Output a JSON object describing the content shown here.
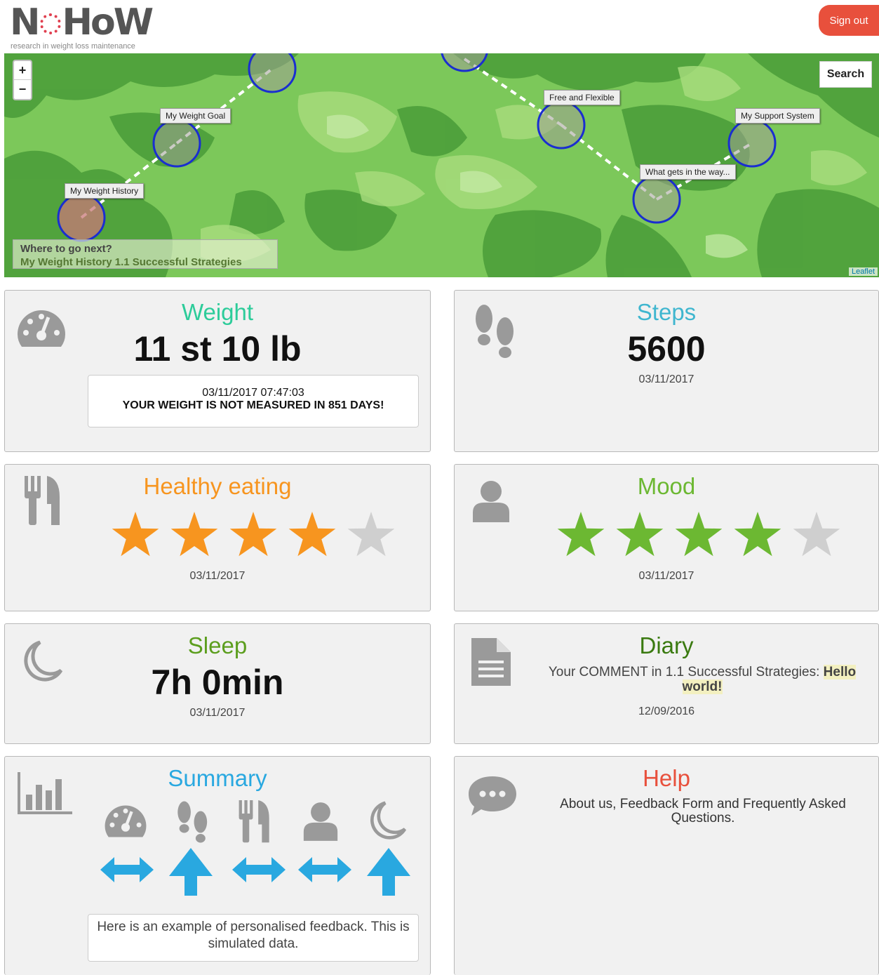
{
  "header": {
    "logo_text_left": "N",
    "logo_text_right": "HoW",
    "tagline": "research in weight loss maintenance",
    "signout_label": "Sign out"
  },
  "map": {
    "zoom_in": "+",
    "zoom_out": "−",
    "search_label": "Search",
    "nodes": [
      "My Weight History",
      "My Weight Goal",
      "Free and Flexible",
      "What gets in the way...",
      "My Support System"
    ],
    "next_title": "Where to go next?",
    "next_links": "My Weight History 1.1 Successful Strategies",
    "attribution": "Leaflet"
  },
  "cards": {
    "weight": {
      "title": "Weight",
      "value": "11 st 10 lb",
      "date": "03/11/2017  07:47:03",
      "warning": "YOUR WEIGHT IS NOT MEASURED IN 851 DAYS!"
    },
    "steps": {
      "title": "Steps",
      "value": "5600",
      "date": "03/11/2017"
    },
    "eating": {
      "title": "Healthy eating",
      "rating": 4,
      "max": 5,
      "date": "03/11/2017"
    },
    "mood": {
      "title": "Mood",
      "rating": 4,
      "max": 5,
      "date": "03/11/2017"
    },
    "sleep": {
      "title": "Sleep",
      "value": "7h 0min",
      "date": "03/11/2017"
    },
    "diary": {
      "title": "Diary",
      "comment_prefix": "Your COMMENT in 1.1 Successful Strategies: ",
      "comment_text": "Hello world!",
      "date": "12/09/2016"
    },
    "summary": {
      "title": "Summary",
      "trends": [
        "steady",
        "up",
        "steady",
        "steady",
        "up"
      ],
      "feedback": "Here is an example of personalised feedback. This is simulated data."
    },
    "help": {
      "title": "Help",
      "text": "About us, Feedback Form and Frequently Asked Questions."
    }
  },
  "colors": {
    "weight": "#2dcc9a",
    "steps": "#3fb6cf",
    "eating": "#f7951f",
    "mood": "#6cb832",
    "sleep": "#5c9e1e",
    "diary": "#3a7a10",
    "summary": "#29a8e0",
    "help": "#e8503c",
    "star_off": "#cfcfcf",
    "icon": "#9a9a9a"
  }
}
